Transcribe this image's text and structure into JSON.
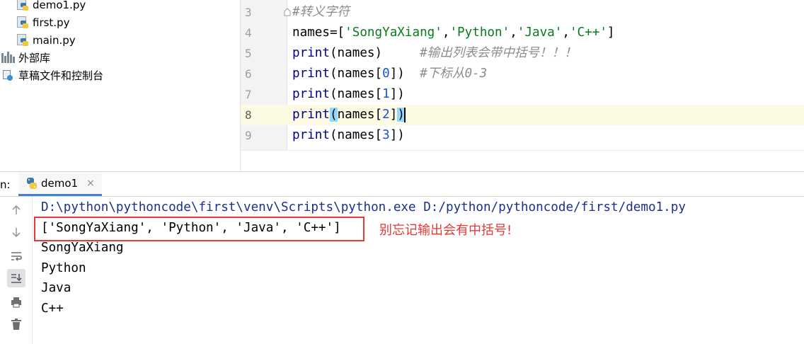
{
  "project_tree": {
    "items": [
      {
        "label": "demo1.py",
        "icon": "python-file-icon"
      },
      {
        "label": "first.py",
        "icon": "python-file-icon"
      },
      {
        "label": "main.py",
        "icon": "python-file-icon"
      },
      {
        "label": "外部库",
        "icon": "library-icon"
      },
      {
        "label": "草稿文件和控制台",
        "icon": "scratches-icon"
      }
    ]
  },
  "editor": {
    "current_line": 8,
    "lines": [
      {
        "number": "3",
        "comment": "#转义字符"
      },
      {
        "number": "4",
        "prefix": "names=[",
        "s1": "'SongYaXiang'",
        "c1": ",",
        "s2": "'Python'",
        "c2": ",",
        "s3": "'Java'",
        "c3": ",",
        "s4": "'C++'",
        "suffix": "]"
      },
      {
        "number": "5",
        "fn": "print",
        "args": "(names)",
        "gap": "     ",
        "comment": "#输出列表会带中括号！！！"
      },
      {
        "number": "6",
        "fn": "print",
        "pre": "(names[",
        "idx": "0",
        "post": "])",
        "gap": "  ",
        "comment": "#下标从0-3"
      },
      {
        "number": "7",
        "fn": "print",
        "pre": "(names[",
        "idx": "1",
        "post": "])"
      },
      {
        "number": "8",
        "fn": "print",
        "open": "(",
        "mid": "names[",
        "idx": "2",
        "close_b": "]",
        "close": ")"
      },
      {
        "number": "9",
        "fn": "print",
        "pre": "(names[",
        "idx": "3",
        "post": "])"
      }
    ]
  },
  "run_panel": {
    "label": "n:",
    "tab_label": "demo1",
    "tab_close": "×",
    "tools": [
      "up-arrow-icon",
      "down-arrow-icon",
      "soft-wrap-icon",
      "scroll-to-end-icon",
      "print-icon",
      "trash-icon"
    ],
    "output": [
      "D:\\python\\pythoncode\\first\\venv\\Scripts\\python.exe D:/python/pythoncode/first/demo1.py",
      "['SongYaXiang', 'Python', 'Java', 'C++']",
      "SongYaXiang",
      "Python",
      "Java",
      "C++"
    ],
    "annotation": "别忘记输出会有中括号!",
    "highlight_color": "#e53935"
  }
}
